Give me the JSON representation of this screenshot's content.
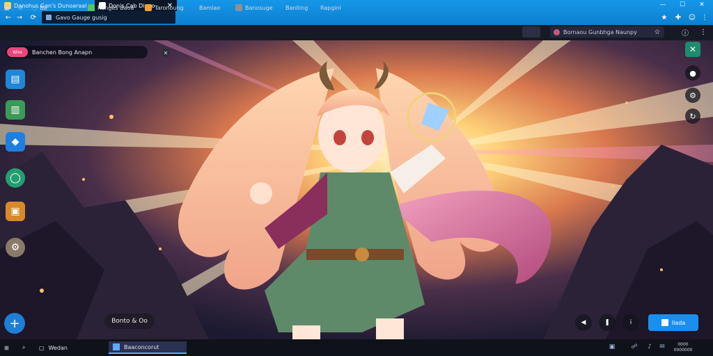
{
  "browser": {
    "tabs": [
      {
        "label": "Danohus Gan's Dunoaraal"
      },
      {
        "label": "Don's Cab Diono"
      }
    ],
    "address_text": "Gavo Gauge gusig",
    "bookmarks": [
      {
        "label": "Ba"
      },
      {
        "label": "Ranges Baoa",
        "color": "#4ec86a"
      },
      {
        "label": "Taronoung",
        "color": "#f0a12a"
      },
      {
        "label": "Bamlao"
      },
      {
        "label": "Banosuge",
        "color": "#8d8f99"
      },
      {
        "label": "Banlling"
      },
      {
        "label": "Rapginl"
      }
    ],
    "bookmark_search": "Bornaou Gunbhga Naunpy"
  },
  "overlay": {
    "chip_badge": "Wire",
    "chip_text": "Banchen Bong Anapn",
    "label_pill": "Bonto & Oo",
    "action_label": "Ilada"
  },
  "taskbar": {
    "app_label": "Wedan",
    "active_window": "Baaconcorut",
    "clock_line1": "0000",
    "clock_line2": "0000000"
  },
  "colors": {
    "titlebar": "#1597e8",
    "accent": "#1a8ff0",
    "chip_badge": "#e9467e"
  },
  "icons": [
    "windows-logo-icon",
    "search-icon",
    "task-view-icon",
    "close-icon",
    "plus-icon",
    "star-icon",
    "gear-icon"
  ]
}
